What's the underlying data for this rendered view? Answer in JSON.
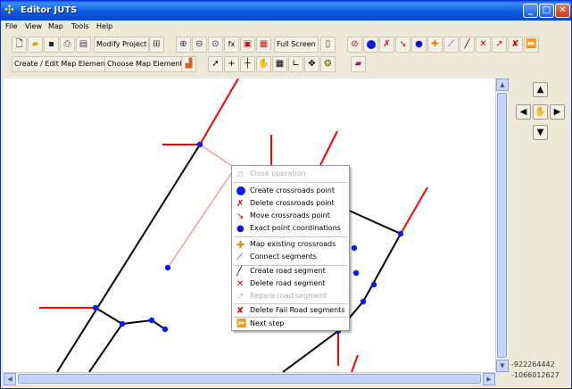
{
  "window": {
    "title": "Editor JUTS"
  },
  "menubar": {
    "items": [
      "File",
      "View",
      "Map",
      "Tools",
      "Help"
    ]
  },
  "toolbar": {
    "modify_project": "Modify Project",
    "full_screen": "Full Screen",
    "create_edit_map_element": "Create / Edit Map Element",
    "choose_map_element": "Choose Map Element",
    "zoom_fit_label": "fx"
  },
  "context_menu": {
    "items": [
      {
        "label": "Close operation",
        "icon": "close-operation-icon",
        "enabled": false
      },
      {
        "label": "Create crossroads point",
        "icon": "create-crossroads-icon",
        "enabled": true
      },
      {
        "label": "Delete crossroads point",
        "icon": "delete-crossroads-icon",
        "enabled": true
      },
      {
        "label": "Move crossroads point",
        "icon": "move-crossroads-icon",
        "enabled": true
      },
      {
        "label": "Exact point coordinations",
        "icon": "exact-point-icon",
        "enabled": true
      },
      {
        "label": "Map existing crossroads",
        "icon": "map-crossroads-icon",
        "enabled": true
      },
      {
        "label": "Connect segments",
        "icon": "connect-segments-icon",
        "enabled": true
      },
      {
        "label": "Create road segment",
        "icon": "create-road-icon",
        "enabled": true
      },
      {
        "label": "Delete road segment",
        "icon": "delete-road-icon",
        "enabled": true
      },
      {
        "label": "Repare road segment",
        "icon": "repair-road-icon",
        "enabled": false
      },
      {
        "label": "Delete Fail Road segments",
        "icon": "delete-fail-road-icon",
        "enabled": true
      },
      {
        "label": "Next step",
        "icon": "next-step-icon",
        "enabled": true
      }
    ]
  },
  "status": {
    "coord_x": "-922264442",
    "coord_y": "-1066012627"
  },
  "colors": {
    "road": "#000000",
    "fail_road": "#ff0000",
    "point": "#0a1cf0",
    "selected_road": "#f0a0a0"
  }
}
